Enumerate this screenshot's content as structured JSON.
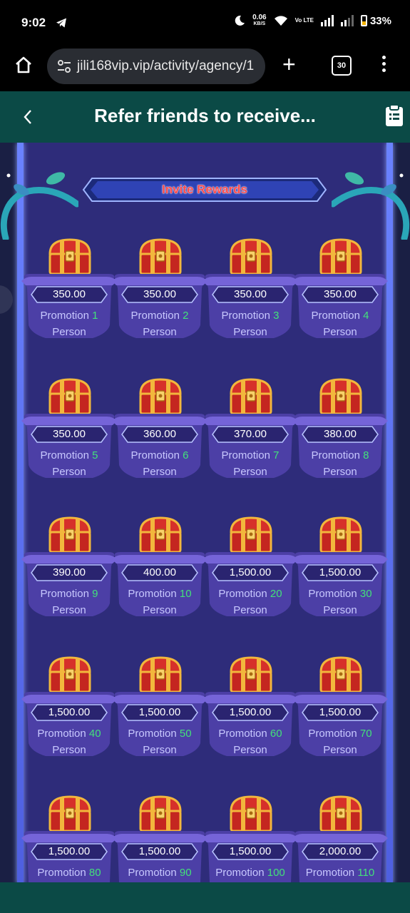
{
  "status_bar": {
    "time": "9:02",
    "speed_value": "0.06",
    "speed_unit": "KB/S",
    "volte": "Vo LTE",
    "battery": "33%"
  },
  "browser": {
    "url": "jili168vip.vip/activity/agency/1",
    "tab_count": "30"
  },
  "header": {
    "title": "Refer friends to receive..."
  },
  "banner": {
    "title": "Invite Rewards"
  },
  "reward_prefix": "Promotion",
  "reward_suffix": "Person",
  "rewards": [
    {
      "amount": "350.00",
      "count": "1"
    },
    {
      "amount": "350.00",
      "count": "2"
    },
    {
      "amount": "350.00",
      "count": "3"
    },
    {
      "amount": "350.00",
      "count": "4"
    },
    {
      "amount": "350.00",
      "count": "5"
    },
    {
      "amount": "360.00",
      "count": "6"
    },
    {
      "amount": "370.00",
      "count": "7"
    },
    {
      "amount": "380.00",
      "count": "8"
    },
    {
      "amount": "390.00",
      "count": "9"
    },
    {
      "amount": "400.00",
      "count": "10"
    },
    {
      "amount": "1,500.00",
      "count": "20"
    },
    {
      "amount": "1,500.00",
      "count": "30"
    },
    {
      "amount": "1,500.00",
      "count": "40"
    },
    {
      "amount": "1,500.00",
      "count": "50"
    },
    {
      "amount": "1,500.00",
      "count": "60"
    },
    {
      "amount": "1,500.00",
      "count": "70"
    },
    {
      "amount": "1,500.00",
      "count": "80"
    },
    {
      "amount": "1,500.00",
      "count": "90"
    },
    {
      "amount": "1,500.00",
      "count": "100"
    },
    {
      "amount": "2,000.00",
      "count": "110"
    }
  ],
  "colors": {
    "header_bg": "#0b4a46",
    "panel_bg": "#2e2c7a",
    "count_color": "#43e07a",
    "banner_text": "#ff4d4d"
  },
  "icons": {
    "home": "home-icon",
    "site_settings": "tune-icon",
    "new_tab": "plus-icon",
    "more": "more-vert-icon",
    "back": "chevron-left-icon",
    "records": "clipboard-icon",
    "reward": "treasure-chest-icon"
  }
}
